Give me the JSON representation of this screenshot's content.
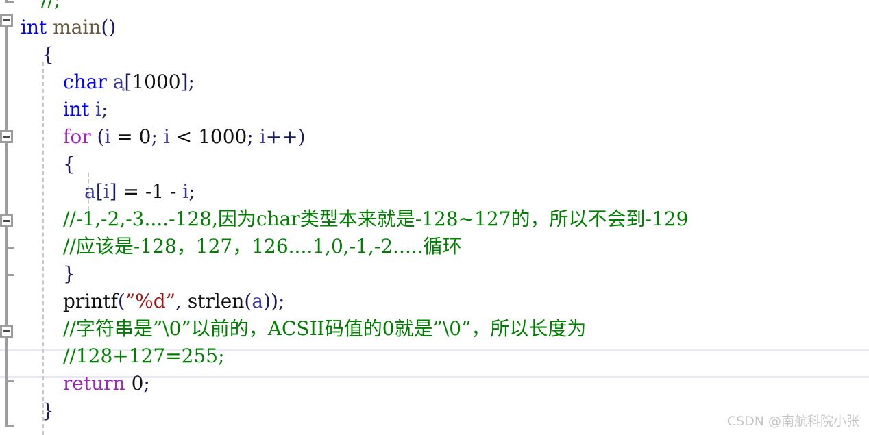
{
  "app": {
    "kind": "code-editor",
    "language": "C"
  },
  "colors": {
    "background": "#ffffff",
    "keyword": "#0000ff",
    "control_keyword": "#a020c0",
    "comment": "#008000",
    "string": "#a31515",
    "identifier": "#2b2b80",
    "function": "#6b5a3e",
    "plain_text": "#111111",
    "current_line_border": "#e8eaf2",
    "fold_marker": "#9d9d9d",
    "indent_guide": "#c8c8c8",
    "watermark": "#c4c4c4"
  },
  "editor": {
    "clipped_top_line": "//;",
    "lines": [
      {
        "id": "line-main",
        "indent": 0,
        "tokens": [
          {
            "t": "int",
            "c": "kw"
          },
          {
            "t": " ",
            "c": "plain"
          },
          {
            "t": "main",
            "c": "fn"
          },
          {
            "t": "()",
            "c": "punct"
          }
        ]
      },
      {
        "id": "line-open-brace-main",
        "indent": 1,
        "tokens": [
          {
            "t": "{",
            "c": "brace"
          }
        ]
      },
      {
        "id": "line-char-decl",
        "indent": 2,
        "tokens": [
          {
            "t": "char",
            "c": "kw"
          },
          {
            "t": " ",
            "c": "plain"
          },
          {
            "t": "a",
            "c": "var"
          },
          {
            "t": "[",
            "c": "punct"
          },
          {
            "t": "1000",
            "c": "num"
          },
          {
            "t": "]",
            "c": "punct"
          },
          {
            "t": ";",
            "c": "punct"
          }
        ]
      },
      {
        "id": "line-int-decl",
        "indent": 2,
        "tokens": [
          {
            "t": "int",
            "c": "kw"
          },
          {
            "t": " ",
            "c": "plain"
          },
          {
            "t": "i",
            "c": "var"
          },
          {
            "t": ";",
            "c": "punct"
          }
        ]
      },
      {
        "id": "line-for",
        "indent": 2,
        "tokens": [
          {
            "t": "for",
            "c": "ctrl"
          },
          {
            "t": " (",
            "c": "punct"
          },
          {
            "t": "i",
            "c": "var"
          },
          {
            "t": " = ",
            "c": "op"
          },
          {
            "t": "0",
            "c": "num"
          },
          {
            "t": "; ",
            "c": "punct"
          },
          {
            "t": "i",
            "c": "var"
          },
          {
            "t": " < ",
            "c": "op"
          },
          {
            "t": "1000",
            "c": "num"
          },
          {
            "t": "; ",
            "c": "punct"
          },
          {
            "t": "i",
            "c": "var"
          },
          {
            "t": "++)",
            "c": "punct"
          }
        ]
      },
      {
        "id": "line-open-brace-for",
        "indent": 2,
        "tokens": [
          {
            "t": "{",
            "c": "brace"
          }
        ]
      },
      {
        "id": "line-assign",
        "indent": 3,
        "tokens": [
          {
            "t": "a",
            "c": "var"
          },
          {
            "t": "[",
            "c": "punct"
          },
          {
            "t": "i",
            "c": "var"
          },
          {
            "t": "]",
            "c": "punct"
          },
          {
            "t": " = ",
            "c": "op"
          },
          {
            "t": "-1",
            "c": "num"
          },
          {
            "t": " - ",
            "c": "op"
          },
          {
            "t": "i",
            "c": "var"
          },
          {
            "t": ";",
            "c": "punct"
          }
        ]
      },
      {
        "id": "line-comment-1",
        "indent": 2,
        "tokens": [
          {
            "t": "//-1,-2,-3....-128,因为char类型本来就是-128~127的，所以不会到-129",
            "c": "cmt"
          }
        ]
      },
      {
        "id": "line-comment-2",
        "indent": 2,
        "tokens": [
          {
            "t": "//应该是-128，127，126....1,0,-1,-2.....循环",
            "c": "cmt"
          }
        ]
      },
      {
        "id": "line-close-brace-for",
        "indent": 2,
        "tokens": [
          {
            "t": "}",
            "c": "brace"
          }
        ]
      },
      {
        "id": "line-printf",
        "indent": 2,
        "tokens": [
          {
            "t": "printf",
            "c": "plain"
          },
          {
            "t": "(",
            "c": "punct"
          },
          {
            "t": "”%d”",
            "c": "str"
          },
          {
            "t": ", ",
            "c": "punct"
          },
          {
            "t": "strlen",
            "c": "plain"
          },
          {
            "t": "(",
            "c": "punct"
          },
          {
            "t": "a",
            "c": "var"
          },
          {
            "t": "));",
            "c": "punct"
          }
        ]
      },
      {
        "id": "line-comment-3",
        "indent": 2,
        "tokens": [
          {
            "t": "//字符串是”\\0”以前的，ACSII码值的0就是”\\0”，所以长度为",
            "c": "cmt"
          }
        ]
      },
      {
        "id": "line-comment-4",
        "indent": 2,
        "highlighted": true,
        "tokens": [
          {
            "t": "//128+127=255;",
            "c": "cmt"
          }
        ]
      },
      {
        "id": "line-return",
        "indent": 2,
        "tokens": [
          {
            "t": "return",
            "c": "ctrl"
          },
          {
            "t": " ",
            "c": "plain"
          },
          {
            "t": "0",
            "c": "num"
          },
          {
            "t": ";",
            "c": "punct"
          }
        ]
      },
      {
        "id": "line-close-brace-main",
        "indent": 1,
        "tokens": [
          {
            "t": "}",
            "c": "brace"
          }
        ]
      }
    ]
  },
  "watermark": {
    "text": "CSDN @南航科院小张"
  }
}
